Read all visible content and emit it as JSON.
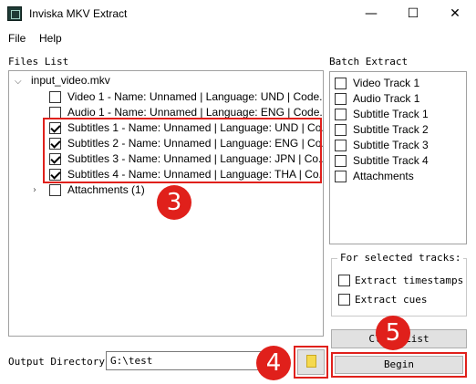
{
  "window": {
    "title": "Inviska MKV Extract",
    "minimize_glyph": "—",
    "maximize_glyph": "☐",
    "close_glyph": "✕"
  },
  "menu": {
    "file": "File",
    "help": "Help"
  },
  "files_list": {
    "label": "Files List",
    "root": "input_video.mkv",
    "tracks": [
      {
        "label": "Video 1 - Name: Unnamed | Language: UND | Code...",
        "checked": false
      },
      {
        "label": "Audio 1 - Name: Unnamed | Language: ENG | Code...",
        "checked": false
      },
      {
        "label": "Subtitles 1 - Name: Unnamed | Language: UND | Co...",
        "checked": true
      },
      {
        "label": "Subtitles 2 - Name: Unnamed | Language: ENG | Co...",
        "checked": true
      },
      {
        "label": "Subtitles 3 - Name: Unnamed | Language: JPN | Co...",
        "checked": true
      },
      {
        "label": "Subtitles 4 - Name: Unnamed | Language: THA | Co...",
        "checked": true
      }
    ],
    "attachments": "Attachments (1)"
  },
  "batch_extract": {
    "label": "Batch Extract",
    "items": [
      {
        "label": "Video Track 1",
        "checked": false
      },
      {
        "label": "Audio Track 1",
        "checked": false
      },
      {
        "label": "Subtitle Track 1",
        "checked": false
      },
      {
        "label": "Subtitle Track 2",
        "checked": false
      },
      {
        "label": "Subtitle Track 3",
        "checked": false
      },
      {
        "label": "Subtitle Track 4",
        "checked": false
      },
      {
        "label": "Attachments",
        "checked": false
      }
    ]
  },
  "selected_tracks": {
    "title": "For selected tracks:",
    "extract_timestamps": "Extract timestamps",
    "extract_cues": "Extract cues"
  },
  "clear_list_button": "Clear List",
  "begin_button": "Begin",
  "output": {
    "label": "Output Directory:",
    "value": "G:\\test"
  },
  "annotations": {
    "badge_3": "3",
    "badge_4": "4",
    "badge_5": "5"
  },
  "colors": {
    "highlight": "#e0201b",
    "button_bg": "#e1e1e1",
    "folder": "#f5d94e"
  }
}
